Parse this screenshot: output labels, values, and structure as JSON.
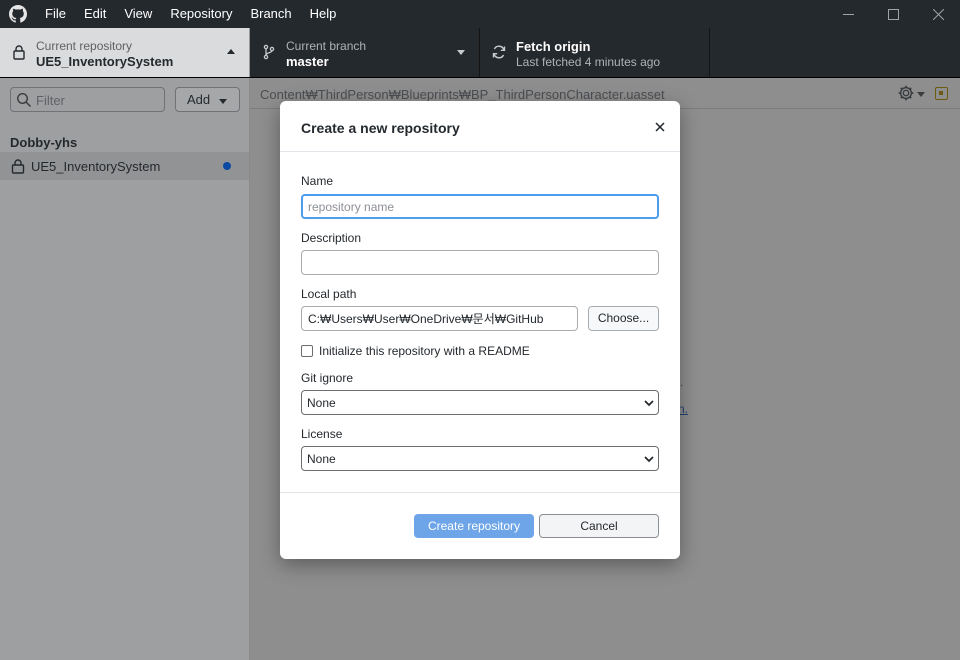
{
  "menu": {
    "items": [
      "File",
      "Edit",
      "View",
      "Repository",
      "Branch",
      "Help"
    ]
  },
  "toolbar": {
    "repository": {
      "label": "Current repository",
      "value": "UE5_InventorySystem"
    },
    "branch": {
      "label": "Current branch",
      "value": "master"
    },
    "fetch": {
      "label": "Fetch origin",
      "value": "Last fetched 4 minutes ago"
    }
  },
  "sidebar": {
    "filter_placeholder": "Filter",
    "add_label": "Add",
    "owner": "Dobby-yhs",
    "repositories": [
      {
        "name": "UE5_InventorySystem",
        "has_changes": true
      }
    ]
  },
  "main": {
    "file_path": "Content₩ThirdPerson₩Blueprints₩BP_ThirdPersonCharacter.uasset",
    "background_fragment_1": ".",
    "background_fragment_2": "n."
  },
  "dialog": {
    "title": "Create a new repository",
    "name_label": "Name",
    "name_placeholder": "repository name",
    "name_value": "",
    "description_label": "Description",
    "description_value": "",
    "local_path_label": "Local path",
    "local_path_value": "C:₩Users₩User₩OneDrive₩문서₩GitHub",
    "choose_label": "Choose...",
    "readme_label": "Initialize this repository with a README",
    "readme_checked": false,
    "gitignore_label": "Git ignore",
    "gitignore_value": "None",
    "license_label": "License",
    "license_value": "None",
    "create_label": "Create repository",
    "cancel_label": "Cancel"
  },
  "colors": {
    "titlebar": "#24292e",
    "primary_button": "#6ea5e8",
    "focus_ring": "#4c9cf0",
    "change_dot": "#0b4aa2"
  }
}
